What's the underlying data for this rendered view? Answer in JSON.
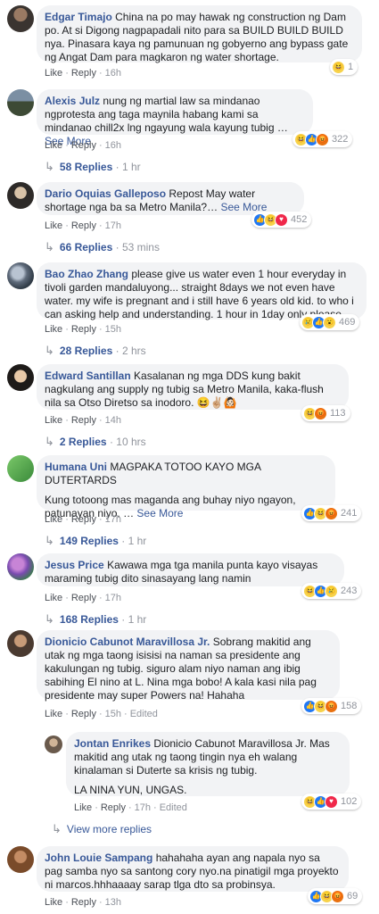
{
  "colors": {
    "link": "#385898",
    "bubble": "#f2f3f5",
    "meta": "#90949c",
    "like": "#2078f4",
    "love": "#f0284a",
    "angry": "#e9710f",
    "haha": "#f7d24a"
  },
  "action_like": "Like",
  "action_reply": "Reply",
  "see_more": "See More",
  "comments": [
    {
      "author": "Edgar Timajo",
      "text": "China na po may hawak ng construction ng Dam po. At si Digong nagpapadali nito para sa BUILD BUILD BUILD nya. Pinasara kaya ng pamunuan ng gobyerno ang bypass gate ng Angat Dam para magkaron ng water shortage.",
      "time": "16h",
      "reactions": [
        "haha"
      ],
      "reaction_count": "1"
    },
    {
      "author": "Alexis Julz",
      "text": "nung ng martial law sa mindanao ngprotesta ang taga maynila habang kami sa mindanao chill2x lng ngayung wala kayung tubig …",
      "time": "16h",
      "reactions": [
        "haha",
        "like",
        "angry"
      ],
      "reaction_count": "322",
      "replies": {
        "label": "58 Replies",
        "time": "1 hr"
      }
    },
    {
      "author": "Dario Oquias Galleposo",
      "text": "Repost May water shortage nga ba sa Metro Manila?…",
      "time": "17h",
      "reactions": [
        "like",
        "haha",
        "love"
      ],
      "reaction_count": "452",
      "replies": {
        "label": "66 Replies",
        "time": "53 mins"
      }
    },
    {
      "author": "Bao Zhao Zhang",
      "text": "please give us water even 1 hour everyday in tivoli garden mandaluyong... straight 8days we not even have water. my wife is pregnant and i still have 6 years old kid. to who i can asking help and understanding. 1 hour in 1day only please",
      "time": "15h",
      "reactions": [
        "sad",
        "like",
        "wow"
      ],
      "reaction_count": "469",
      "replies": {
        "label": "28 Replies",
        "time": "2 hrs"
      }
    },
    {
      "author": "Edward Santillan",
      "text": "Kasalanan ng mga DDS kung bakit nagkulang ang supply ng tubig sa Metro Manila, kaka-flush nila sa Otso Diretso sa inodoro. 😆✌🏼🙆🏻",
      "time": "14h",
      "reactions": [
        "haha",
        "angry"
      ],
      "reaction_count": "113",
      "replies": {
        "label": "2 Replies",
        "time": "10 hrs"
      }
    },
    {
      "author": "Humana Uni",
      "text": "MAGPAKA TOTOO KAYO MGA DUTERTARDS",
      "text2": "Kung totoong mas maganda ang buhay niyo ngayon, patunayan niyo. …",
      "time": "17h",
      "reactions": [
        "like",
        "haha",
        "angry"
      ],
      "reaction_count": "241",
      "replies": {
        "label": "149 Replies",
        "time": "1 hr"
      }
    },
    {
      "author": "Jesus Price",
      "text": "Kawawa mga tga manila punta kayo visayas maraming tubig dito sinasayang lang namin",
      "time": "17h",
      "reactions": [
        "haha",
        "like",
        "sad"
      ],
      "reaction_count": "243",
      "replies": {
        "label": "168 Replies",
        "time": "1 hr"
      }
    },
    {
      "author": "Dionicio Cabunot Maravillosa Jr.",
      "text": "Sobrang makitid ang utak ng mga taong isisisi na naman sa presidente ang kakulungan ng tubig. siguro alam niyo naman ang ibig sabihing El nino at L. Nina mga bobo! A kala kasi nila pag presidente may super Powers na! Hahaha",
      "time": "15h",
      "edited": "Edited",
      "reactions": [
        "like",
        "haha",
        "angry"
      ],
      "reaction_count": "158"
    },
    {
      "author": "Jontan Enrikes",
      "text": "Dionicio Cabunot Maravillosa Jr. Mas makitid ang utak ng taong tingin nya eh walang kinalaman si Duterte sa krisis ng tubig.",
      "text2": "LA NINA YUN, UNGAS.",
      "time": "17h",
      "edited": "Edited",
      "reactions": [
        "haha",
        "like",
        "love"
      ],
      "reaction_count": "102"
    },
    {
      "view_more": "View more replies"
    },
    {
      "author": "John Louie Sampang",
      "text": "hahahaha ayan ang napala nyo sa pag samba nyo sa santong cory nyo.na pinatigil mga proyekto ni marcos.hhhaaaay sarap tlga dto sa probinsya.",
      "time": "13h",
      "reactions": [
        "like",
        "haha",
        "angry"
      ],
      "reaction_count": "69"
    }
  ]
}
